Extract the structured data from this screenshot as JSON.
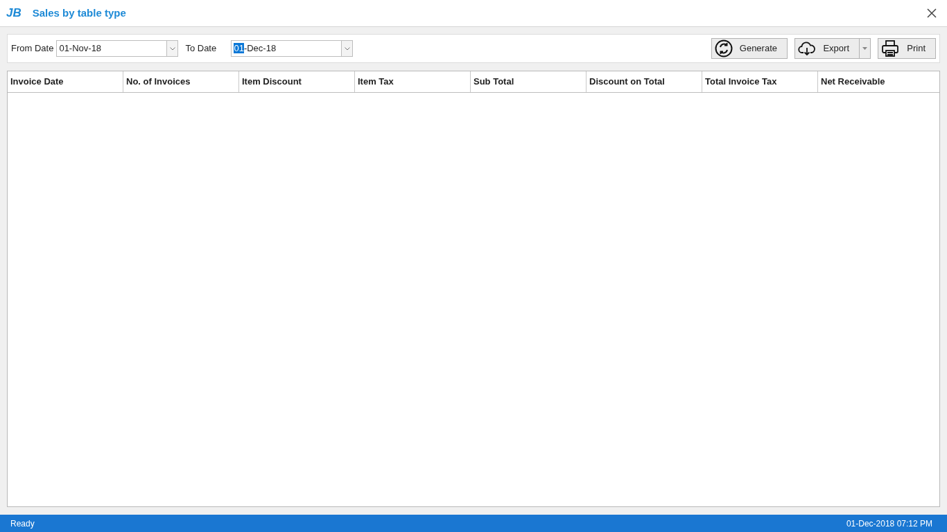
{
  "window": {
    "logo": "JB",
    "title": "Sales by table type"
  },
  "filters": [
    {
      "label": "From Date",
      "value": [
        {
          "text": "01-Nov-18",
          "selected": false
        }
      ]
    },
    {
      "label": "To Date",
      "value": [
        {
          "text": "01",
          "selected": true
        },
        {
          "text": "-Dec-18",
          "selected": false
        }
      ]
    }
  ],
  "buttons": [
    {
      "kind": "refresh",
      "label": "Generate",
      "dropdown": false
    },
    {
      "kind": "cloud",
      "label": "Export",
      "dropdown": true
    },
    {
      "kind": "printer",
      "label": "Print",
      "dropdown": false
    }
  ],
  "table": {
    "columns": [
      "Invoice Date",
      "No. of Invoices",
      "Item Discount",
      "Item Tax",
      "Sub Total",
      "Discount on Total",
      "Total Invoice Tax",
      "Net Receivable"
    ]
  },
  "status_bar": {
    "status": "Ready",
    "datetime": "01-Dec-2018 07:12 PM"
  }
}
